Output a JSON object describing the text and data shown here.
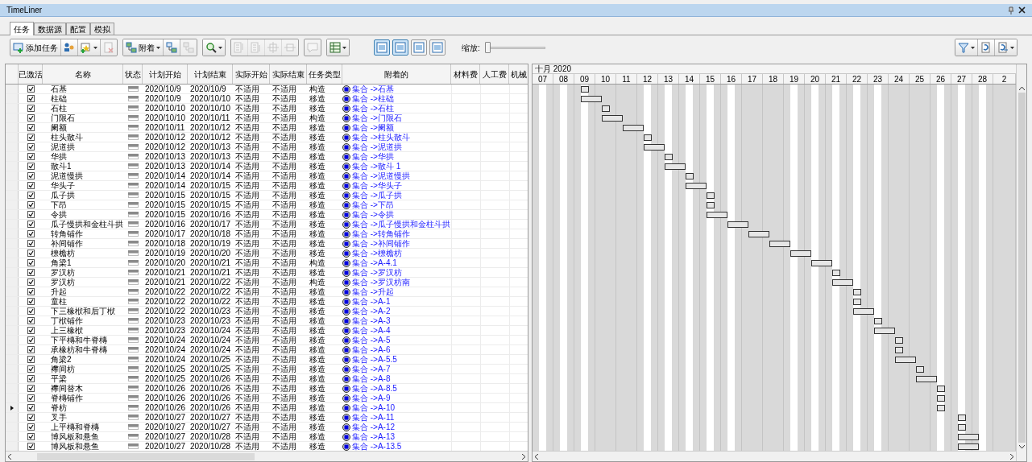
{
  "window": {
    "title": "TimeLiner"
  },
  "tabs": [
    {
      "label": "任务",
      "selected": true
    },
    {
      "label": "数据源",
      "selected": false
    },
    {
      "label": "配置",
      "selected": false
    },
    {
      "label": "模拟",
      "selected": false
    }
  ],
  "toolbar": {
    "groups": [
      [
        {
          "label": "添加任务",
          "disabled": false,
          "dropdown": false
        },
        {
          "disabled": false,
          "dropdown": false
        },
        {
          "disabled": false,
          "dropdown": true
        },
        {
          "disabled": true,
          "dropdown": false
        }
      ],
      [
        {
          "label": "附着",
          "disabled": false,
          "dropdown": true
        },
        {
          "disabled": false,
          "dropdown": false
        },
        {
          "disabled": true,
          "dropdown": false
        }
      ],
      [
        {
          "disabled": false,
          "dropdown": true
        }
      ],
      [
        {
          "disabled": true,
          "dropdown": false
        },
        {
          "disabled": true,
          "dropdown": false
        },
        {
          "disabled": true,
          "dropdown": false
        },
        {
          "disabled": true,
          "dropdown": false
        }
      ],
      [
        {
          "disabled": true,
          "dropdown": false
        }
      ],
      [
        {
          "disabled": false,
          "dropdown": true
        }
      ]
    ],
    "view_buttons": [
      {
        "selected": true
      },
      {
        "selected": true
      },
      {
        "selected": false
      },
      {
        "selected": false
      }
    ],
    "zoom": {
      "label": "缩放:",
      "level": 0
    },
    "right_group": [
      {
        "disabled": false,
        "dropdown": true
      },
      {
        "disabled": false,
        "dropdown": false
      },
      {
        "disabled": false,
        "dropdown": true
      }
    ]
  },
  "table": {
    "columns": [
      "已激活",
      "名称",
      "状态",
      "计划开始",
      "计划结束",
      "实际开始",
      "实际结束",
      "任务类型",
      "附着的",
      "材料费",
      "人工费",
      "机械"
    ],
    "rows": [
      {
        "selected": false,
        "active": true,
        "name": "石基",
        "plan_start": "2020/10/9",
        "plan_end": "2020/10/9",
        "actual_start": "不适用",
        "actual_end": "不适用",
        "task_type": "构造",
        "attached": "集合 ->石基"
      },
      {
        "selected": false,
        "active": true,
        "name": "柱础",
        "plan_start": "2020/10/9",
        "plan_end": "2020/10/10",
        "actual_start": "不适用",
        "actual_end": "不适用",
        "task_type": "移造",
        "attached": "集合 ->柱础"
      },
      {
        "selected": false,
        "active": true,
        "name": "石柱",
        "plan_start": "2020/10/10",
        "plan_end": "2020/10/10",
        "actual_start": "不适用",
        "actual_end": "不适用",
        "task_type": "移造",
        "attached": "集合 ->石柱"
      },
      {
        "selected": false,
        "active": true,
        "name": "门限石",
        "plan_start": "2020/10/10",
        "plan_end": "2020/10/11",
        "actual_start": "不适用",
        "actual_end": "不适用",
        "task_type": "构造",
        "attached": "集合 ->门限石"
      },
      {
        "selected": false,
        "active": true,
        "name": "阑额",
        "plan_start": "2020/10/11",
        "plan_end": "2020/10/12",
        "actual_start": "不适用",
        "actual_end": "不适用",
        "task_type": "移造",
        "attached": "集合 ->阑额"
      },
      {
        "selected": false,
        "active": true,
        "name": "柱头散斗",
        "plan_start": "2020/10/12",
        "plan_end": "2020/10/12",
        "actual_start": "不适用",
        "actual_end": "不适用",
        "task_type": "移造",
        "attached": "集合 ->柱头散斗"
      },
      {
        "selected": false,
        "active": true,
        "name": "泥道拱",
        "plan_start": "2020/10/12",
        "plan_end": "2020/10/13",
        "actual_start": "不适用",
        "actual_end": "不适用",
        "task_type": "移造",
        "attached": "集合 ->泥道拱"
      },
      {
        "selected": false,
        "active": true,
        "name": "华拱",
        "plan_start": "2020/10/13",
        "plan_end": "2020/10/13",
        "actual_start": "不适用",
        "actual_end": "不适用",
        "task_type": "移造",
        "attached": "集合 ->华拱"
      },
      {
        "selected": false,
        "active": true,
        "name": "散斗1",
        "plan_start": "2020/10/13",
        "plan_end": "2020/10/14",
        "actual_start": "不适用",
        "actual_end": "不适用",
        "task_type": "移造",
        "attached": "集合 ->散斗 1"
      },
      {
        "selected": false,
        "active": true,
        "name": "泥道慢拱",
        "plan_start": "2020/10/14",
        "plan_end": "2020/10/14",
        "actual_start": "不适用",
        "actual_end": "不适用",
        "task_type": "移造",
        "attached": "集合 ->泥道慢拱"
      },
      {
        "selected": false,
        "active": true,
        "name": "华头子",
        "plan_start": "2020/10/14",
        "plan_end": "2020/10/15",
        "actual_start": "不适用",
        "actual_end": "不适用",
        "task_type": "移造",
        "attached": "集合 ->华头子"
      },
      {
        "selected": false,
        "active": true,
        "name": "瓜子拱",
        "plan_start": "2020/10/15",
        "plan_end": "2020/10/15",
        "actual_start": "不适用",
        "actual_end": "不适用",
        "task_type": "移造",
        "attached": "集合 ->瓜子拱"
      },
      {
        "selected": false,
        "active": true,
        "name": "下昂",
        "plan_start": "2020/10/15",
        "plan_end": "2020/10/15",
        "actual_start": "不适用",
        "actual_end": "不适用",
        "task_type": "移造",
        "attached": "集合 ->下昂"
      },
      {
        "selected": false,
        "active": true,
        "name": "令拱",
        "plan_start": "2020/10/15",
        "plan_end": "2020/10/16",
        "actual_start": "不适用",
        "actual_end": "不适用",
        "task_type": "移造",
        "attached": "集合 ->令拱"
      },
      {
        "selected": false,
        "active": true,
        "name": "瓜子慢拱和金柱斗拱",
        "plan_start": "2020/10/16",
        "plan_end": "2020/10/17",
        "actual_start": "不适用",
        "actual_end": "不适用",
        "task_type": "移造",
        "attached": "集合 ->瓜子慢拱和金柱斗拱"
      },
      {
        "selected": false,
        "active": true,
        "name": "转角铺作",
        "plan_start": "2020/10/17",
        "plan_end": "2020/10/18",
        "actual_start": "不适用",
        "actual_end": "不适用",
        "task_type": "移造",
        "attached": "集合 ->转角铺作"
      },
      {
        "selected": false,
        "active": true,
        "name": "补间铺作",
        "plan_start": "2020/10/18",
        "plan_end": "2020/10/19",
        "actual_start": "不适用",
        "actual_end": "不适用",
        "task_type": "移造",
        "attached": "集合 ->补间铺作"
      },
      {
        "selected": false,
        "active": true,
        "name": "橑檐枋",
        "plan_start": "2020/10/19",
        "plan_end": "2020/10/20",
        "actual_start": "不适用",
        "actual_end": "不适用",
        "task_type": "移造",
        "attached": "集合 ->橑檐枋"
      },
      {
        "selected": false,
        "active": true,
        "name": "角梁1",
        "plan_start": "2020/10/20",
        "plan_end": "2020/10/21",
        "actual_start": "不适用",
        "actual_end": "不适用",
        "task_type": "构造",
        "attached": "集合 ->A-4.1"
      },
      {
        "selected": false,
        "active": true,
        "name": "罗汉枋",
        "plan_start": "2020/10/21",
        "plan_end": "2020/10/21",
        "actual_start": "不适用",
        "actual_end": "不适用",
        "task_type": "移造",
        "attached": "集合 ->罗汉枋"
      },
      {
        "selected": false,
        "active": true,
        "name": "罗汉枋",
        "plan_start": "2020/10/21",
        "plan_end": "2020/10/22",
        "actual_start": "不适用",
        "actual_end": "不适用",
        "task_type": "构造",
        "attached": "集合 ->罗汉枋南"
      },
      {
        "selected": false,
        "active": true,
        "name": "升起",
        "plan_start": "2020/10/22",
        "plan_end": "2020/10/22",
        "actual_start": "不适用",
        "actual_end": "不适用",
        "task_type": "移造",
        "attached": "集合 ->升起"
      },
      {
        "selected": false,
        "active": true,
        "name": "童柱",
        "plan_start": "2020/10/22",
        "plan_end": "2020/10/22",
        "actual_start": "不适用",
        "actual_end": "不适用",
        "task_type": "移造",
        "attached": "集合 ->A-1"
      },
      {
        "selected": false,
        "active": true,
        "name": "下三椽栿和后丁栿",
        "plan_start": "2020/10/22",
        "plan_end": "2020/10/23",
        "actual_start": "不适用",
        "actual_end": "不适用",
        "task_type": "移造",
        "attached": "集合 ->A-2"
      },
      {
        "selected": false,
        "active": true,
        "name": "丁栿铺作",
        "plan_start": "2020/10/23",
        "plan_end": "2020/10/23",
        "actual_start": "不适用",
        "actual_end": "不适用",
        "task_type": "移造",
        "attached": "集合 ->A-3"
      },
      {
        "selected": false,
        "active": true,
        "name": "上三椽栿",
        "plan_start": "2020/10/23",
        "plan_end": "2020/10/24",
        "actual_start": "不适用",
        "actual_end": "不适用",
        "task_type": "移造",
        "attached": "集合 ->A-4"
      },
      {
        "selected": false,
        "active": true,
        "name": "下平槫和牛脊槫",
        "plan_start": "2020/10/24",
        "plan_end": "2020/10/24",
        "actual_start": "不适用",
        "actual_end": "不适用",
        "task_type": "移造",
        "attached": "集合 ->A-5"
      },
      {
        "selected": false,
        "active": true,
        "name": "承椽枋和牛脊槫",
        "plan_start": "2020/10/24",
        "plan_end": "2020/10/24",
        "actual_start": "不适用",
        "actual_end": "不适用",
        "task_type": "移造",
        "attached": "集合 ->A-6"
      },
      {
        "selected": false,
        "active": true,
        "name": "角梁2",
        "plan_start": "2020/10/24",
        "plan_end": "2020/10/25",
        "actual_start": "不适用",
        "actual_end": "不适用",
        "task_type": "移造",
        "attached": "集合 ->A-5.5"
      },
      {
        "selected": false,
        "active": true,
        "name": "襻间枋",
        "plan_start": "2020/10/25",
        "plan_end": "2020/10/25",
        "actual_start": "不适用",
        "actual_end": "不适用",
        "task_type": "移造",
        "attached": "集合 ->A-7"
      },
      {
        "selected": false,
        "active": true,
        "name": "平梁",
        "plan_start": "2020/10/25",
        "plan_end": "2020/10/26",
        "actual_start": "不适用",
        "actual_end": "不适用",
        "task_type": "移造",
        "attached": "集合 ->A-8"
      },
      {
        "selected": false,
        "active": true,
        "name": "襻间替木",
        "plan_start": "2020/10/26",
        "plan_end": "2020/10/26",
        "actual_start": "不适用",
        "actual_end": "不适用",
        "task_type": "移造",
        "attached": "集合 ->A-8.5"
      },
      {
        "selected": false,
        "active": true,
        "name": "脊槫铺作",
        "plan_start": "2020/10/26",
        "plan_end": "2020/10/26",
        "actual_start": "不适用",
        "actual_end": "不适用",
        "task_type": "移造",
        "attached": "集合 ->A-9"
      },
      {
        "selected": true,
        "active": true,
        "name": "脊枋",
        "plan_start": "2020/10/26",
        "plan_end": "2020/10/26",
        "actual_start": "不适用",
        "actual_end": "不适用",
        "task_type": "移造",
        "attached": "集合 ->A-10"
      },
      {
        "selected": false,
        "active": true,
        "name": "叉手",
        "plan_start": "2020/10/27",
        "plan_end": "2020/10/27",
        "actual_start": "不适用",
        "actual_end": "不适用",
        "task_type": "移造",
        "attached": "集合 ->A-11"
      },
      {
        "selected": false,
        "active": true,
        "name": "上平槫和脊槫",
        "plan_start": "2020/10/27",
        "plan_end": "2020/10/27",
        "actual_start": "不适用",
        "actual_end": "不适用",
        "task_type": "移造",
        "attached": "集合 ->A-12"
      },
      {
        "selected": false,
        "active": true,
        "name": "博风板和悬鱼",
        "plan_start": "2020/10/27",
        "plan_end": "2020/10/28",
        "actual_start": "不适用",
        "actual_end": "不适用",
        "task_type": "移造",
        "attached": "集合 ->A-13"
      },
      {
        "selected": false,
        "active": true,
        "name": "博风板和悬鱼",
        "plan_start": "2020/10/27",
        "plan_end": "2020/10/28",
        "actual_start": "不适用",
        "actual_end": "不适用",
        "task_type": "移造",
        "attached": "集合 ->A-13.5"
      }
    ]
  },
  "gantt": {
    "month": "十月 2020",
    "days": [
      "07",
      "08",
      "09",
      "10",
      "11",
      "12",
      "13",
      "14",
      "15",
      "16",
      "17",
      "18",
      "19",
      "20",
      "21",
      "22",
      "23",
      "24",
      "25",
      "26",
      "27",
      "28",
      "2"
    ]
  }
}
